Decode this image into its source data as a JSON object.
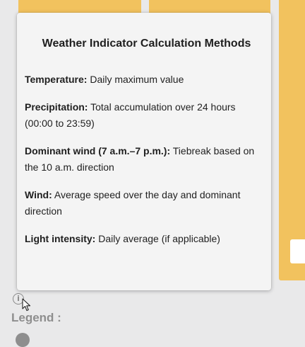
{
  "tooltip": {
    "title": "Weather Indicator Calculation Methods",
    "methods": [
      {
        "term": "Temperature:",
        "description": " Daily maximum value"
      },
      {
        "term": "Precipitation:",
        "description": " Total accumulation over 24 hours (00:00 to 23:59)"
      },
      {
        "term": "Dominant wind (7 a.m.–7 p.m.):",
        "description": " Tiebreak based on the 10 a.m. direction"
      },
      {
        "term": "Wind:",
        "description": " Average speed over the day and dominant direction"
      },
      {
        "term": "Light intensity:",
        "description": " Daily average (if applicable)"
      }
    ]
  },
  "legend": {
    "label": "Legend :"
  },
  "icons": {
    "info": "info-icon",
    "cursor": "pointer-cursor-icon"
  },
  "colors": {
    "card": "#f2c25e",
    "background": "#e9e9ea",
    "tooltip_bg": "#f4f4f4"
  }
}
